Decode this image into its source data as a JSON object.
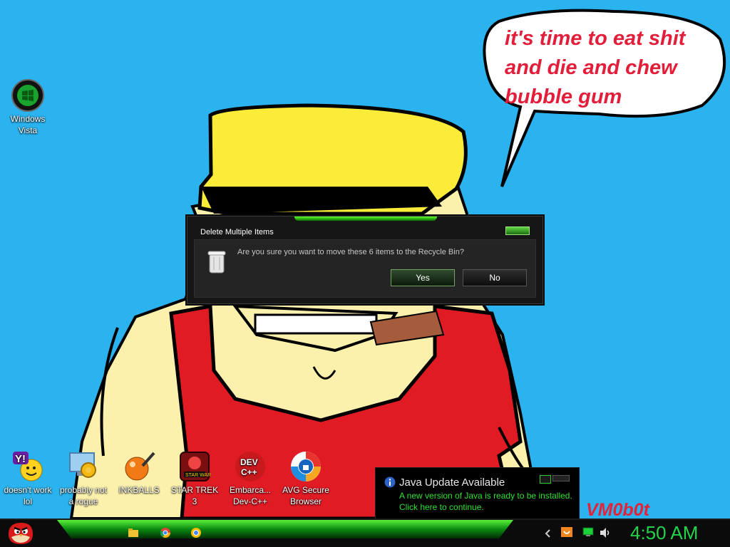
{
  "speech_bubble": {
    "lines": [
      "it's time to eat shit",
      "and die and chew",
      "bubble gum"
    ]
  },
  "watermark": "VM0b0t",
  "desktop_icons": [
    {
      "id": "windows-vista",
      "lines": [
        "Windows",
        "Vista"
      ]
    },
    {
      "id": "doesnt-work-lol",
      "lines": [
        "doesn't work",
        "lol"
      ]
    },
    {
      "id": "probably-not-a-rogue",
      "lines": [
        "probably not",
        "a rogue"
      ]
    },
    {
      "id": "inkballs",
      "lines": [
        "INKBALLS"
      ]
    },
    {
      "id": "star-trek-3",
      "lines": [
        "STAR TREK",
        "3"
      ]
    },
    {
      "id": "embarcadero-dev-cpp",
      "lines": [
        "Embarca...",
        "Dev-C++"
      ]
    },
    {
      "id": "avg-secure-browser",
      "lines": [
        "AVG Secure",
        "Browser"
      ]
    }
  ],
  "dialog": {
    "title": "Delete Multiple Items",
    "message": "Are you sure you want to move these 6 items to the Recycle Bin?",
    "yes_label": "Yes",
    "no_label": "No"
  },
  "notification": {
    "title": "Java Update Available",
    "line1": "A new version of Java is ready to be installed.",
    "line2": "Click here to continue."
  },
  "taskbar": {
    "clock": "4:50 AM",
    "pinned": [
      "file-explorer-icon",
      "chrome-icon",
      "chrome-alt-icon"
    ]
  },
  "colors": {
    "sky": "#2ab3ef",
    "caption_red": "#e31e3a",
    "accent_green": "#23d44a"
  }
}
